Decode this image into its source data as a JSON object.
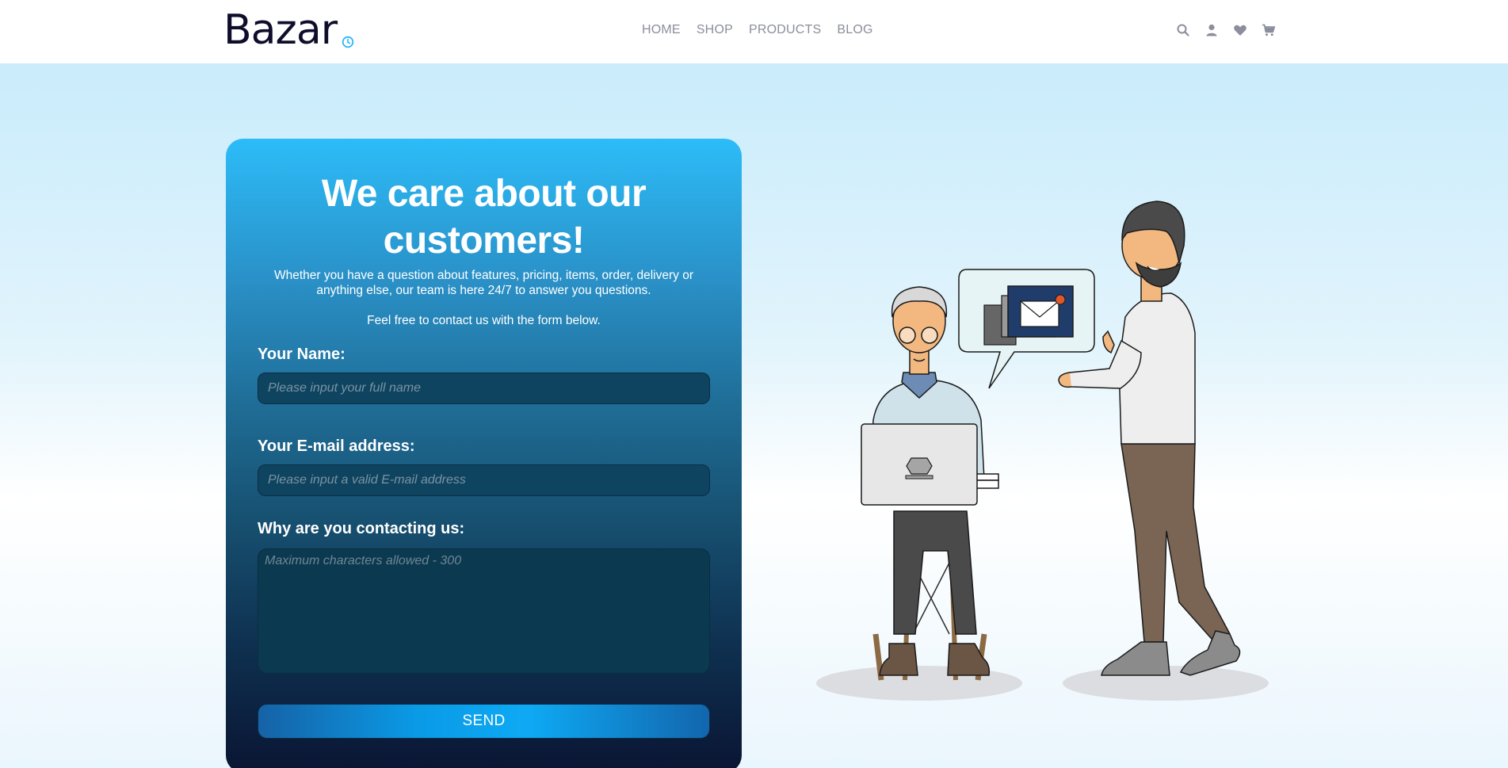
{
  "header": {
    "logo": "Bazar",
    "nav": [
      "HOME",
      "SHOP",
      "PRODUCTS",
      "BLOG"
    ],
    "icons": [
      "search-icon",
      "user-icon",
      "heart-icon",
      "cart-icon"
    ]
  },
  "contact_form": {
    "title": "We care about our customers!",
    "subtitle": "Whether you have a question about features, pricing, items, order, delivery or anything else, our team is here 24/7 to answer you questions.",
    "cta_text": "Feel free to contact us with the form below.",
    "name_label": "Your Name:",
    "name_placeholder": "Please input your full name",
    "email_label": "Your E-mail address:",
    "email_placeholder": "Please input a valid E-mail address",
    "reason_label": "Why are you contacting us:",
    "reason_placeholder": "Maximum characters allowed - 300",
    "send_label": "SEND"
  },
  "colors": {
    "brand_text": "#0e0e2c",
    "accent": "#29b6f6",
    "nav_text": "#8b8e9c"
  }
}
